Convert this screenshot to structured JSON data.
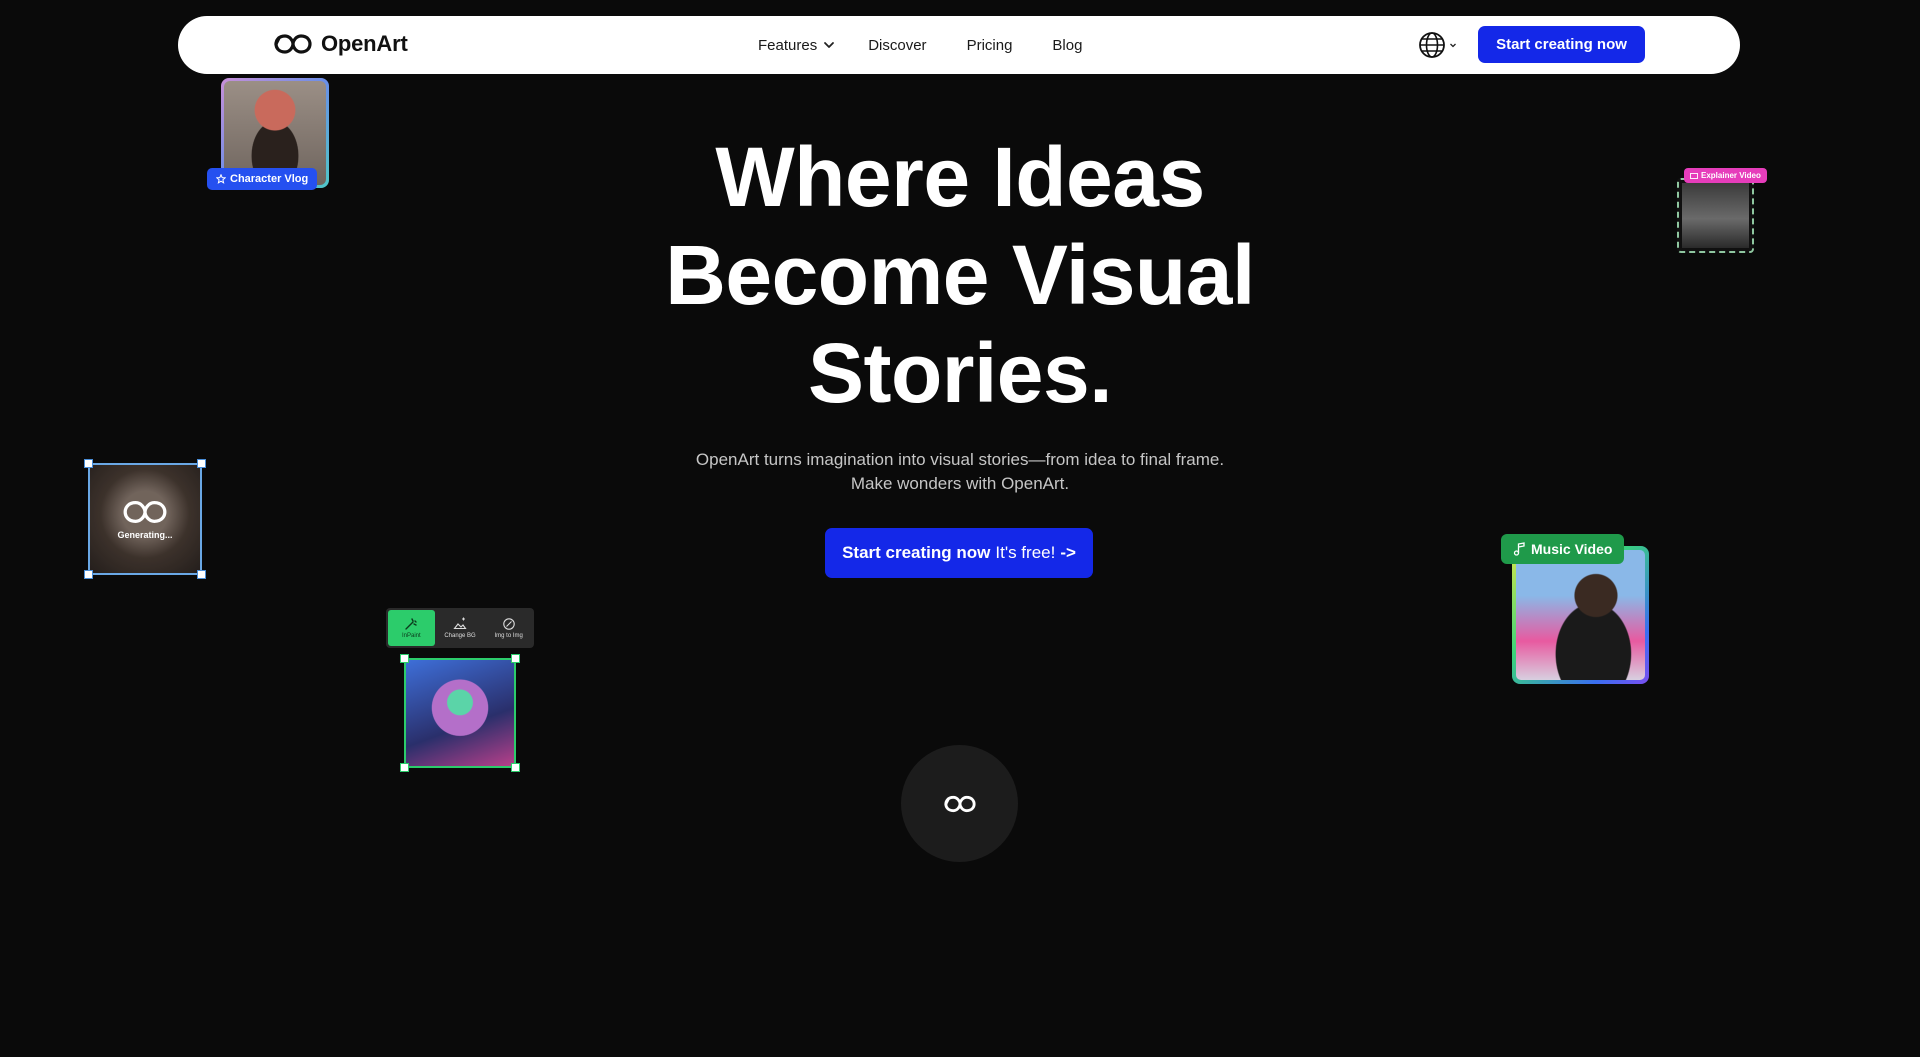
{
  "nav": {
    "brand": "OpenArt",
    "links": {
      "features": "Features",
      "discover": "Discover",
      "pricing": "Pricing",
      "blog": "Blog"
    },
    "cta": "Start creating now"
  },
  "hero": {
    "title_lines": [
      "Where Ideas",
      "Become Visual",
      "Stories."
    ],
    "subtitle_lines": [
      "OpenArt turns imagination into visual stories—from idea to final frame.",
      "Make wonders with OpenArt."
    ],
    "cta_bold": "Start creating now",
    "cta_free": "It's free!",
    "cta_arrow": "->"
  },
  "cards": {
    "character_vlog": "Character Vlog",
    "explainer_video": "Explainer Video",
    "generating": "Generating...",
    "toolbar": {
      "inpaint": "InPaint",
      "change_bg": "Change BG",
      "img_to_img": "Img to Img"
    },
    "music_video": "Music Video"
  },
  "colors": {
    "background": "#0a0a0a",
    "accent": "#1428e8",
    "inpaint_green": "#2ccc6b",
    "music_badge": "#1f9a4a",
    "explainer_badge": "#e63dbb",
    "character_badge": "#2550f0"
  },
  "icons": {
    "brand": "infinity-logo-icon",
    "features_dropdown": "chevron-down-icon",
    "language": "globe-icon"
  }
}
